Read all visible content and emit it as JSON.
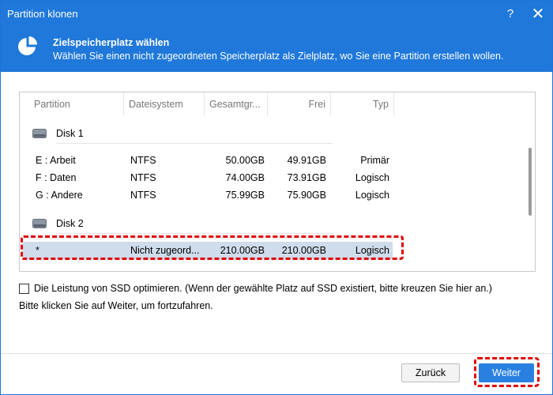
{
  "window": {
    "title": "Partition klonen",
    "help_label": "?",
    "close_label": "✕"
  },
  "banner": {
    "icon": "pie-chart-icon",
    "heading": "Zielspeicherplatz wählen",
    "subtitle": "Wählen Sie einen nicht zugeordneten Speicherplatz als Zielplatz, wo Sie eine Partition erstellen wollen."
  },
  "table": {
    "columns": [
      "Partition",
      "Dateisystem",
      "Gesamtgr...",
      "Frei",
      "Typ"
    ],
    "disks": [
      {
        "label": "Disk 1",
        "partitions": [
          {
            "partition": "E :  Arbeit",
            "fs": "NTFS",
            "total": "50.00GB",
            "free": "49.91GB",
            "type": "Primär"
          },
          {
            "partition": "F :  Daten",
            "fs": "NTFS",
            "total": "74.00GB",
            "free": "73.91GB",
            "type": "Logisch"
          },
          {
            "partition": "G :  Andere",
            "fs": "NTFS",
            "total": "75.99GB",
            "free": "75.90GB",
            "type": "Logisch"
          }
        ]
      },
      {
        "label": "Disk 2",
        "partitions": [
          {
            "partition": "*",
            "fs": "Nicht zugeord...",
            "total": "210.00GB",
            "free": "210.00GB",
            "type": "Logisch",
            "selected": true
          }
        ]
      }
    ]
  },
  "options": {
    "ssd_optimize_label": "Die Leistung von SSD optimieren. (Wenn der gewählte Platz auf SSD existiert, bitte kreuzen Sie hier an.)",
    "ssd_optimize_checked": false,
    "hint": "Bitte klicken Sie auf Weiter, um fortzufahren."
  },
  "footer": {
    "back_label": "Zurück",
    "next_label": "Weiter"
  },
  "colors": {
    "accent": "#1f78da",
    "selection": "#cfdcec",
    "highlight_outline": "#e00000"
  }
}
